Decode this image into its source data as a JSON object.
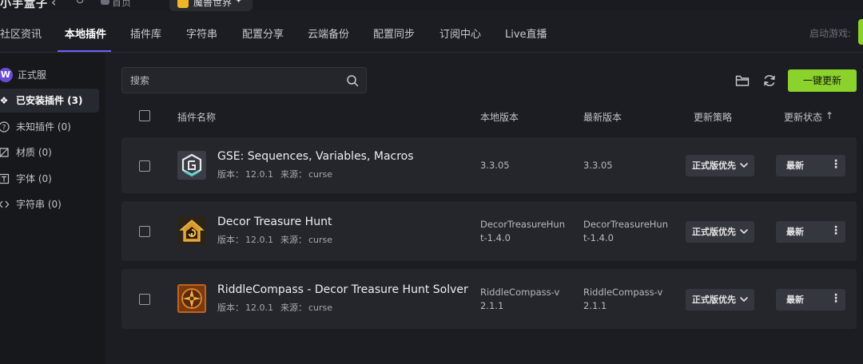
{
  "titlebar": {
    "app_title": "小手盒子",
    "tab_home_label": "首页",
    "tab_active_label": "魔兽世界"
  },
  "nav": {
    "items": [
      {
        "label": "社区资讯"
      },
      {
        "label": "本地插件"
      },
      {
        "label": "插件库"
      },
      {
        "label": "字符串"
      },
      {
        "label": "配置分享"
      },
      {
        "label": "云端备份"
      },
      {
        "label": "配置同步"
      },
      {
        "label": "订阅中心"
      },
      {
        "label": "Live直播"
      }
    ],
    "active_index": 1,
    "launch_label": "启动游戏:"
  },
  "sidebar": {
    "items": [
      {
        "label": "正式服",
        "icon": "wow-logo-icon"
      },
      {
        "label": "已安装插件 (3)",
        "icon": "diamond-icon"
      },
      {
        "label": "未知插件 (0)",
        "icon": "question-icon"
      },
      {
        "label": "材质 (0)",
        "icon": "texture-icon"
      },
      {
        "label": "字体 (0)",
        "icon": "font-icon"
      },
      {
        "label": "字符串 (0)",
        "icon": "string-icon"
      }
    ]
  },
  "toolbar": {
    "search_placeholder": "搜索",
    "update_all_label": "一键更新"
  },
  "table": {
    "headers": {
      "name": "插件名称",
      "local_version": "本地版本",
      "latest_version": "最新版本",
      "strategy": "更新策略",
      "status": "更新状态",
      "sort_indicator": "↑"
    },
    "rows": [
      {
        "name": "GSE: Sequences, Variables, Macros",
        "version_label": "版本：",
        "version": "12.0.1",
        "source_label": "来源：",
        "source": "curse",
        "local_version": "3.3.05",
        "latest_version": "3.3.05",
        "strategy": "正式版优先",
        "status": "最新",
        "icon": "gse-icon"
      },
      {
        "name": "Decor Treasure Hunt",
        "version_label": "版本：",
        "version": "12.0.1",
        "source_label": "来源：",
        "source": "curse",
        "local_version": "DecorTreasureHunt-1.4.0",
        "latest_version": "DecorTreasureHunt-1.4.0",
        "strategy": "正式版优先",
        "status": "最新",
        "icon": "house-icon"
      },
      {
        "name": "RiddleCompass - Decor Treasure Hunt Solver",
        "version_label": "版本：",
        "version": "12.0.1",
        "source_label": "来源：",
        "source": "curse",
        "local_version": "RiddleCompass-v2.1.1",
        "latest_version": "RiddleCompass-v2.1.1",
        "strategy": "正式版优先",
        "status": "最新",
        "icon": "compass-icon"
      }
    ]
  },
  "colors": {
    "accent_green": "#8bd22d",
    "accent_purple": "#6f5ff7",
    "row_bg": "#25262c"
  }
}
